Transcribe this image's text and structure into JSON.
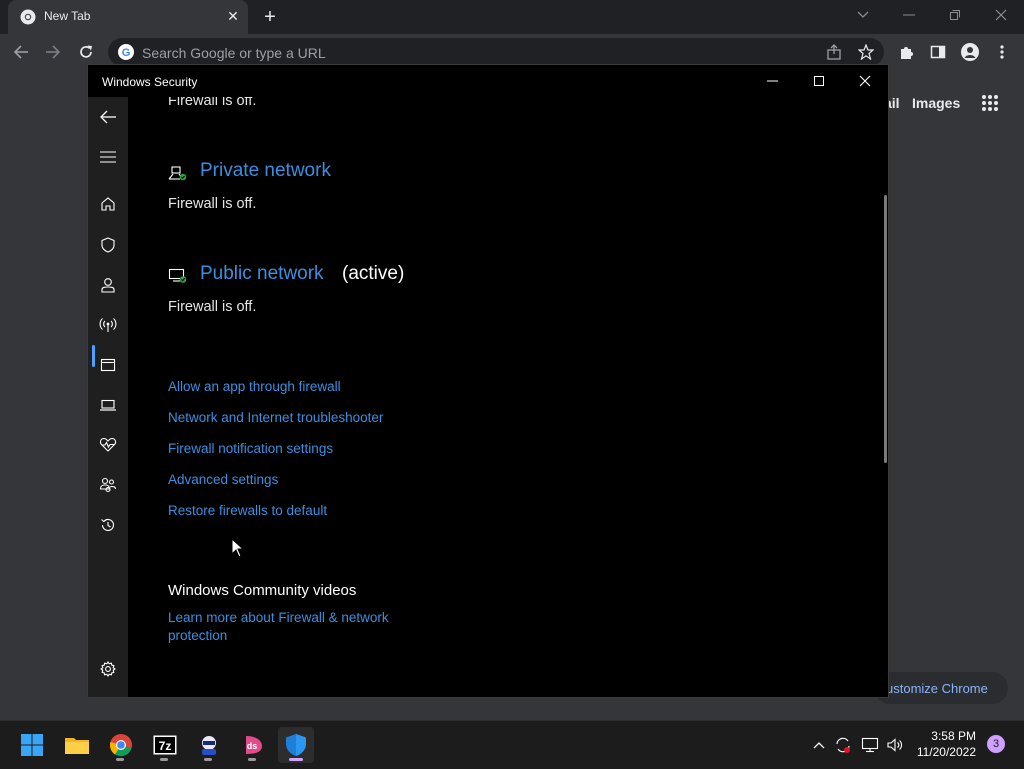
{
  "browser": {
    "tab_title": "New Tab",
    "tab_close": "✕",
    "new_tab": "+",
    "omnibox_placeholder": "Search Google or type a URL",
    "google_links": {
      "gmail_partial": "ail",
      "images": "Images"
    },
    "customize_label": "ustomize Chrome"
  },
  "app": {
    "title": "Windows Security",
    "sections": {
      "domain_status": "Firewall is off.",
      "private_network": {
        "name": "Private network",
        "status": "Firewall is off."
      },
      "public_network": {
        "name": "Public network",
        "active_tag": "(active)",
        "status": "Firewall is off."
      }
    },
    "links": [
      "Allow an app through firewall",
      "Network and Internet troubleshooter",
      "Firewall notification settings",
      "Advanced settings",
      "Restore firewalls to default"
    ],
    "community": {
      "heading": "Windows Community videos",
      "link_line1": "Learn more about Firewall & network",
      "link_line2": "protection"
    },
    "sidebar_icons": [
      "back-icon",
      "menu-icon",
      "home-icon",
      "shield-icon",
      "account-icon",
      "firewall-network-icon",
      "app-browser-icon",
      "device-security-icon",
      "device-health-icon",
      "family-icon",
      "history-icon",
      "settings-icon"
    ]
  },
  "taskbar": {
    "time": "3:58 PM",
    "date": "11/20/2022",
    "notification_count": "3",
    "apps": [
      "start-icon",
      "file-explorer-icon",
      "chrome-icon",
      "7zip-icon",
      "app-icon",
      "app-icon-2",
      "windows-security-icon"
    ]
  },
  "colors": {
    "accent": "#3b8fe0",
    "chrome_bg": "#35363a",
    "window_bg": "#000000"
  }
}
